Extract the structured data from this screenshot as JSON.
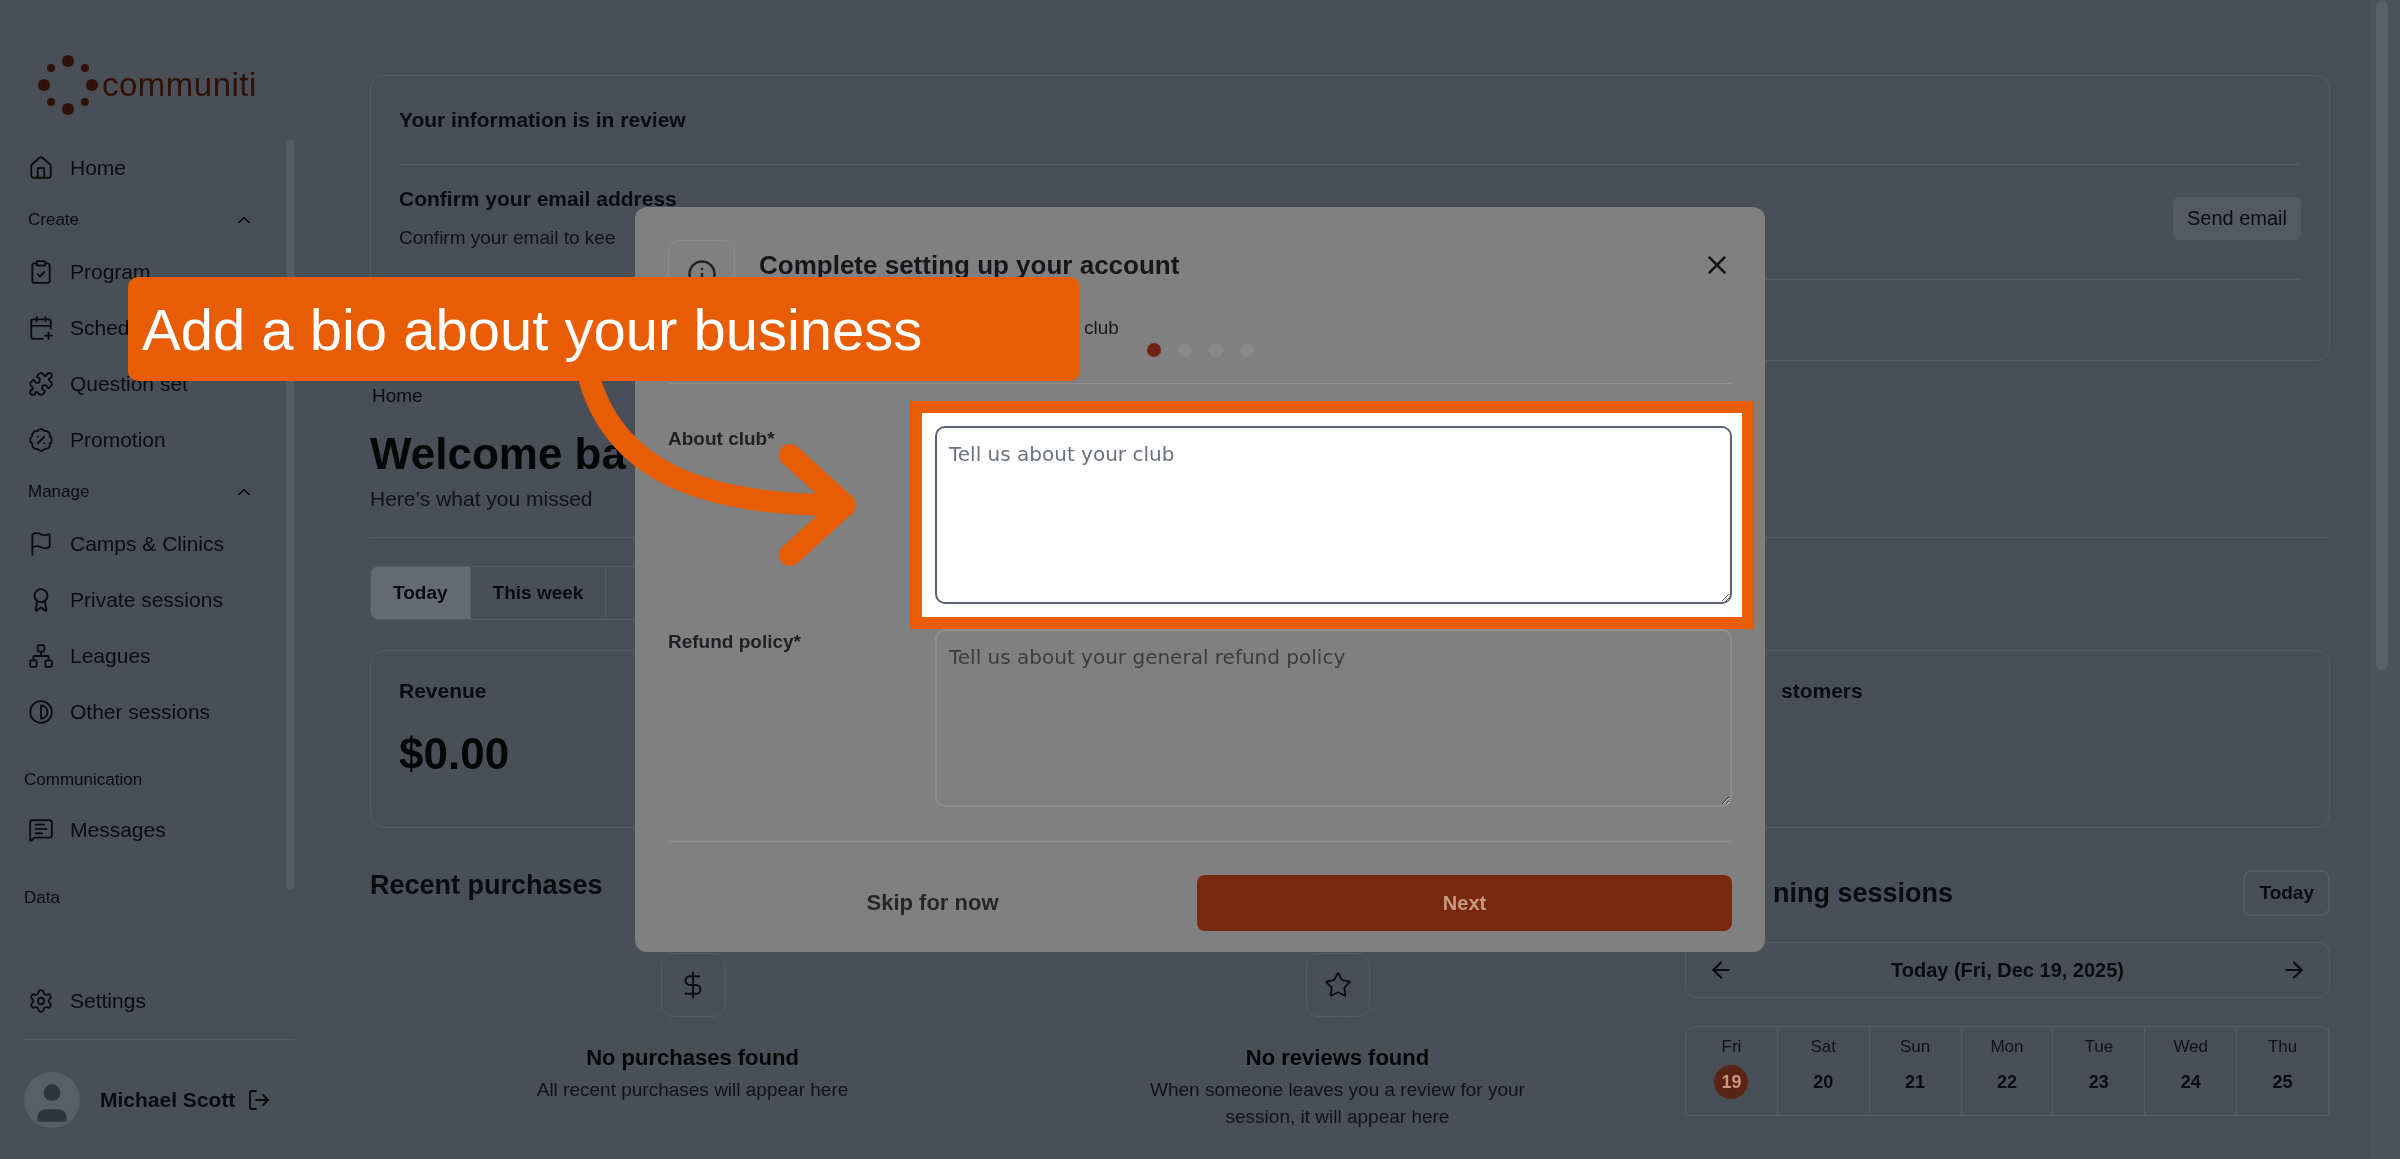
{
  "logo": {
    "text": "communiti"
  },
  "sidebar": {
    "items": [
      {
        "kind": "link",
        "label": "Home"
      },
      {
        "kind": "section",
        "label": "Create",
        "expanded": true
      },
      {
        "kind": "link",
        "label": "Program"
      },
      {
        "kind": "link",
        "label": "Sched"
      },
      {
        "kind": "link",
        "label": "Question set"
      },
      {
        "kind": "link",
        "label": "Promotion"
      },
      {
        "kind": "section",
        "label": "Manage",
        "expanded": true
      },
      {
        "kind": "link",
        "label": "Camps & Clinics"
      },
      {
        "kind": "link",
        "label": "Private sessions"
      },
      {
        "kind": "link",
        "label": "Leagues"
      },
      {
        "kind": "link",
        "label": "Other sessions"
      },
      {
        "kind": "heading",
        "label": "Communication"
      },
      {
        "kind": "link",
        "label": "Messages"
      },
      {
        "kind": "heading",
        "label": "Data"
      }
    ],
    "settings": "Settings",
    "user": "Michael Scott"
  },
  "review_card": {
    "title": "Your information is in review",
    "email_title": "Confirm your email address",
    "email_text": "Confirm your email to kee",
    "send_button": "Send email"
  },
  "breadcrumb": "Home",
  "heading": "Welcome ba",
  "subheading": "Here’s what you missed",
  "period_tabs": [
    {
      "label": "Today",
      "selected": true
    },
    {
      "label": "This week",
      "selected": false
    }
  ],
  "stats": [
    {
      "label": "Revenue",
      "value": "$0.00"
    },
    {
      "label": "stomers"
    }
  ],
  "recent_purchases": {
    "title": "Recent purchases",
    "empty_states": [
      {
        "title": "No purchases found",
        "text": "All recent purchases will appear here"
      },
      {
        "title": "No reviews found",
        "text": "When someone leaves you a review for your session, it will appear here"
      }
    ]
  },
  "sessions": {
    "title": "ning sessions",
    "today_button": "Today",
    "date_label": "Today (Fri, Dec 19, 2025)",
    "days": [
      {
        "weekday": "Fri",
        "date": "19",
        "selected": true
      },
      {
        "weekday": "Sat",
        "date": "20",
        "selected": false
      },
      {
        "weekday": "Sun",
        "date": "21",
        "selected": false
      },
      {
        "weekday": "Mon",
        "date": "22",
        "selected": false
      },
      {
        "weekday": "Tue",
        "date": "23",
        "selected": false
      },
      {
        "weekday": "Wed",
        "date": "24",
        "selected": false
      },
      {
        "weekday": "Thu",
        "date": "25",
        "selected": false
      }
    ]
  },
  "modal": {
    "title": "Complete setting up your account",
    "subtitle": "club",
    "steps": [
      {
        "selected": true
      },
      {
        "selected": false
      },
      {
        "selected": false
      },
      {
        "selected": false
      }
    ],
    "fields": [
      {
        "label": "About club*",
        "placeholder": "Tell us about your club",
        "highlighted": true
      },
      {
        "label": "Refund policy*",
        "placeholder": "Tell us about your general refund policy",
        "highlighted": false
      }
    ],
    "skip_button": "Skip for now",
    "next_button": "Next"
  },
  "annotation": {
    "text": "Add a bio about your business"
  }
}
